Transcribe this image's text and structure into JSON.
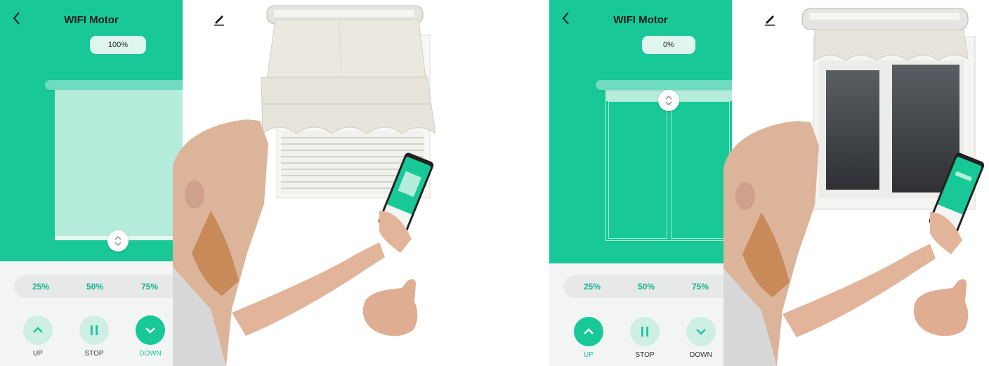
{
  "app": {
    "title": "WIFI Motor"
  },
  "screens": [
    {
      "percentage": "100%",
      "presets": [
        "25%",
        "50%",
        "75%"
      ],
      "controls": {
        "up": "UP",
        "stop": "STOP",
        "down": "DOWN"
      },
      "active_control": "down"
    },
    {
      "percentage": "0%",
      "presets": [
        "25%",
        "50%",
        "75%"
      ],
      "controls": {
        "up": "UP",
        "stop": "STOP",
        "down": "DOWN"
      },
      "active_control": "up"
    }
  ],
  "icons": {
    "back": "chevron-left-icon",
    "edit": "pencil-icon",
    "handle": "drag-updown-icon",
    "up": "chevron-up-icon",
    "stop": "pause-icon",
    "down": "chevron-down-icon"
  },
  "colors": {
    "accent": "#18c897",
    "accent_light": "#cfeee4",
    "blind": "#b5ecdc",
    "preset_text": "#18b489",
    "active_label": "#18c897"
  }
}
